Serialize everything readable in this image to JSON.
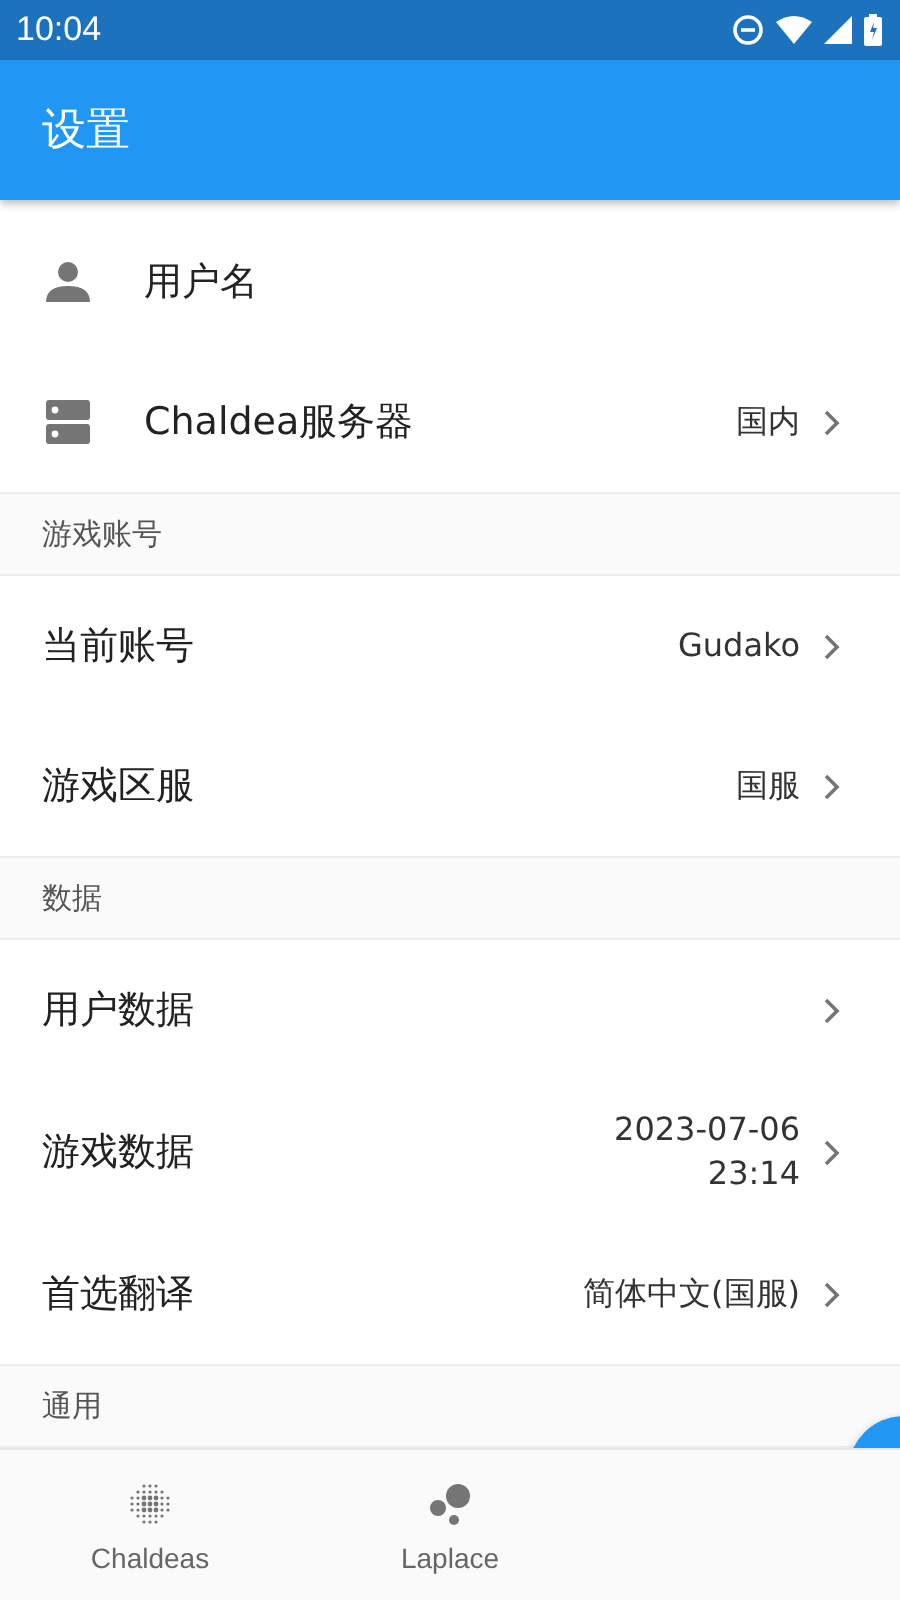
{
  "status_bar": {
    "time": "10:04"
  },
  "app_bar": {
    "title": "设置"
  },
  "sections": [
    {
      "items": [
        {
          "label": "用户名",
          "chevron": false
        },
        {
          "label": "Chaldea服务器",
          "value": [
            "国内"
          ],
          "chevron": true
        }
      ]
    },
    {
      "header": "游戏账号",
      "items": [
        {
          "label": "当前账号",
          "value": [
            "Gudako"
          ],
          "chevron": true
        },
        {
          "label": "游戏区服",
          "value": [
            "国服"
          ],
          "chevron": true
        }
      ]
    },
    {
      "header": "数据",
      "items": [
        {
          "label": "用户数据",
          "chevron": true
        },
        {
          "label": "游戏数据",
          "value": [
            "2023-07-06",
            "23:14"
          ],
          "chevron": true
        },
        {
          "label": "首选翻译",
          "value": [
            "简体中文(国服)"
          ],
          "chevron": true
        }
      ]
    },
    {
      "header": "通用"
    }
  ],
  "bottom_nav": [
    {
      "label": "Chaldeas",
      "selected": false
    },
    {
      "label": "Laplace",
      "selected": false
    }
  ]
}
